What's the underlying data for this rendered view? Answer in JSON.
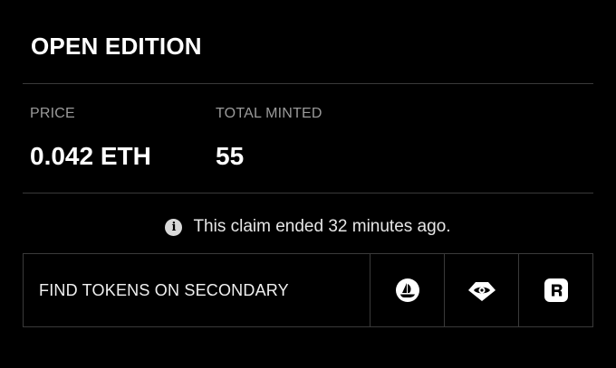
{
  "header": {
    "title": "OPEN EDITION"
  },
  "stats": [
    {
      "label": "PRICE",
      "value": "0.042 ETH"
    },
    {
      "label": "TOTAL MINTED",
      "value": "55"
    }
  ],
  "notice": {
    "icon": "info-icon",
    "text": "This claim ended 32 minutes ago."
  },
  "secondary": {
    "label": "FIND TOKENS ON SECONDARY",
    "buttons": [
      {
        "icon": "opensea-icon"
      },
      {
        "icon": "looksrare-eye-icon"
      },
      {
        "icon": "rarible-icon"
      }
    ]
  },
  "colors": {
    "background": "#000000",
    "text": "#ffffff",
    "muted": "#9a9a9a",
    "border": "#3a3a3a"
  }
}
